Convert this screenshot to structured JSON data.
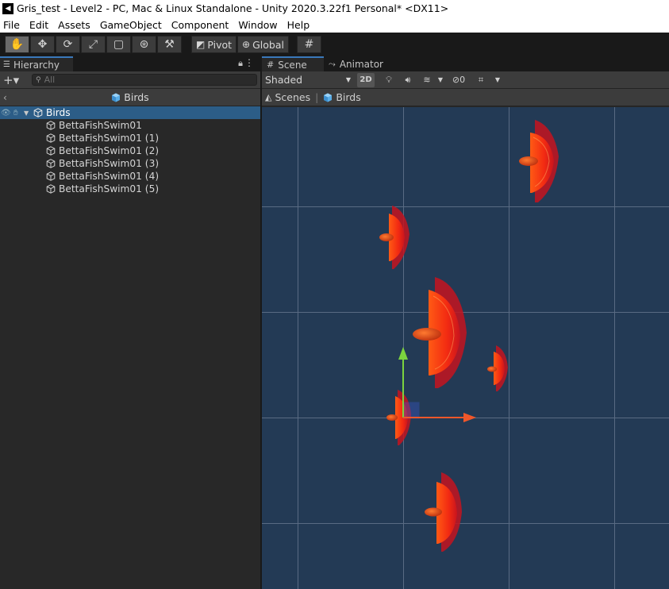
{
  "window": {
    "title": "Gris_test - Level2 - PC, Mac & Linux Standalone - Unity 2020.3.22f1 Personal* <DX11>"
  },
  "menu": [
    "File",
    "Edit",
    "Assets",
    "GameObject",
    "Component",
    "Window",
    "Help"
  ],
  "toolbar": {
    "tools": [
      {
        "name": "hand-tool",
        "glyph": "✋",
        "active": true
      },
      {
        "name": "move-tool",
        "glyph": "✥"
      },
      {
        "name": "rotate-tool",
        "glyph": "⟳"
      },
      {
        "name": "scale-tool",
        "glyph": "⤢"
      },
      {
        "name": "rect-tool",
        "glyph": "▢"
      },
      {
        "name": "transform-tool",
        "glyph": "⊛"
      },
      {
        "name": "custom-tool",
        "glyph": "⚒"
      }
    ],
    "pivot_label": "Pivot",
    "global_label": "Global",
    "grid_snap_glyph": "#"
  },
  "hierarchy": {
    "tab_label": "Hierarchy",
    "search_placeholder": "All",
    "breadcrumb": "Birds",
    "root": "Birds",
    "children": [
      "BettaFishSwim01",
      "BettaFishSwim01 (1)",
      "BettaFishSwim01 (2)",
      "BettaFishSwim01 (3)",
      "BettaFishSwim01 (4)",
      "BettaFishSwim01 (5)"
    ]
  },
  "scene": {
    "tabs": [
      {
        "label": "Scene",
        "active": true
      },
      {
        "label": "Animator",
        "active": false
      }
    ],
    "shading_mode": "Shaded",
    "two_d_label": "2D",
    "hidden_count": "0",
    "breadcrumb_root": "Scenes",
    "breadcrumb_current": "Birds"
  },
  "colors": {
    "accent": "#3a79bb",
    "selection": "#2c5d87",
    "scene_bg": "#233a55",
    "grid": "#6d7e92",
    "fish_body": "#ff3b10",
    "gizmo_y": "#7bd33e",
    "gizmo_x": "#f0572a",
    "gizmo_z": "#3b5bd6"
  }
}
